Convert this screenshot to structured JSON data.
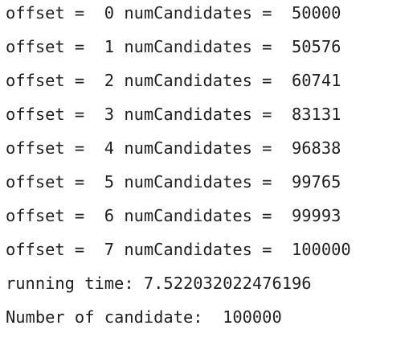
{
  "output": {
    "lines": [
      "offset =  0 numCandidates =  50000",
      "offset =  1 numCandidates =  50576",
      "offset =  2 numCandidates =  60741",
      "offset =  3 numCandidates =  83131",
      "offset =  4 numCandidates =  96838",
      "offset =  5 numCandidates =  99765",
      "offset =  6 numCandidates =  99993",
      "offset =  7 numCandidates =  100000",
      "running time: 7.522032022476196",
      "Number of candidate:  100000"
    ]
  }
}
